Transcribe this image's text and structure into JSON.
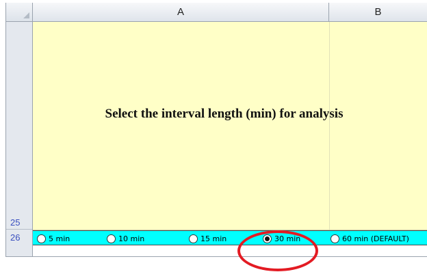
{
  "columns": {
    "a": "A",
    "b": "B"
  },
  "rows": {
    "r25": "25",
    "r26": "26"
  },
  "prompt_text": "Select the interval length (min) for analysis",
  "options": [
    {
      "label": "5 min",
      "selected": false
    },
    {
      "label": "10 min",
      "selected": false
    },
    {
      "label": "15 min",
      "selected": false
    },
    {
      "label": "30 min",
      "selected": true
    },
    {
      "label": "60 min (DEFAULT)",
      "selected": false
    }
  ],
  "colors": {
    "yellow_fill": "#ffffc7",
    "option_row_fill": "#00ffff",
    "highlight": "#e31b23",
    "row_number_text": "#3a4fbf"
  }
}
